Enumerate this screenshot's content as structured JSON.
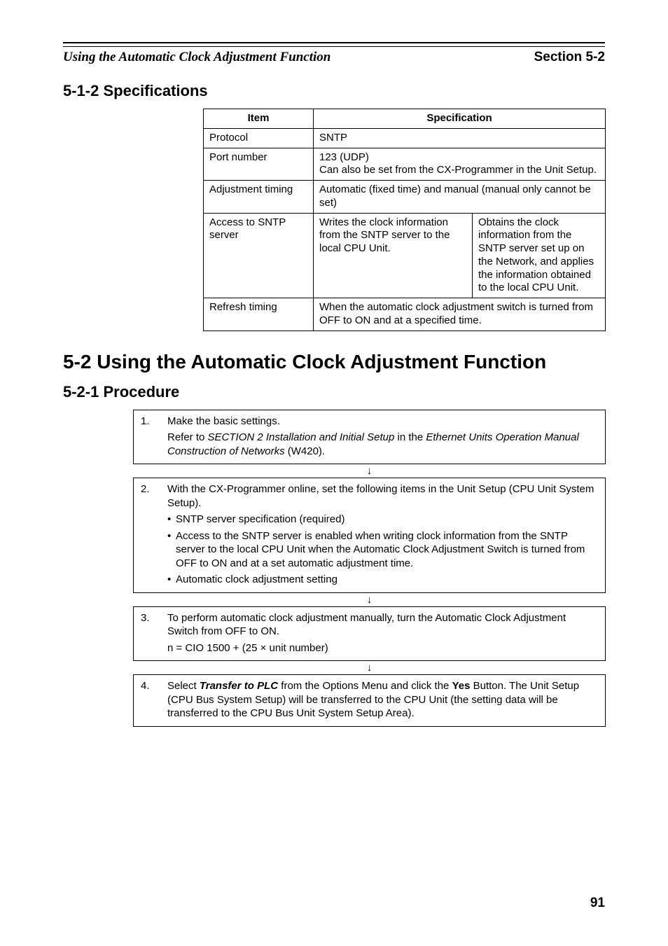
{
  "header": {
    "running_title": "Using the Automatic Clock Adjustment Function",
    "section_ref": "Section 5-2"
  },
  "h3_1": "5-1-2    Specifications",
  "spec_table": {
    "head_item": "Item",
    "head_spec": "Specification",
    "rows": {
      "protocol_label": "Protocol",
      "protocol_value": "SNTP",
      "port_label": "Port number",
      "port_value_l1": "123 (UDP)",
      "port_value_l2": "Can also be set from the CX-Programmer in the Unit Setup.",
      "adj_label": "Adjustment timing",
      "adj_value": "Automatic (fixed time) and manual (manual only cannot be set)",
      "access_label": "Access to SNTP server",
      "access_left": "Writes the clock information from the SNTP server to the local CPU Unit.",
      "access_right": "Obtains the clock information from the SNTP server set up on the Network, and applies the information obtained to the local CPU Unit.",
      "refresh_label": "Refresh timing",
      "refresh_value": "When the automatic clock adjustment switch is turned from OFF to ON and at a specified time."
    }
  },
  "h2": "5-2    Using the Automatic Clock Adjustment Function",
  "h3_2": "5-2-1    Procedure",
  "steps": {
    "s1_num": "1.",
    "s1_line1": "Make the basic settings.",
    "s1_line2a": "Refer to ",
    "s1_line2b": "SECTION 2 Installation and Initial Setup",
    "s1_line2c": " in the ",
    "s1_line2d": "Ethernet Units Operation Manual Construction of Networks",
    "s1_line2e": " (W420).",
    "s2_num": "2.",
    "s2_line1": "With the CX-Programmer online, set the following items in the Unit Setup (CPU Unit System Setup).",
    "s2_b1": "SNTP server specification (required)",
    "s2_b2": "Access to the SNTP server is enabled when writing clock information from the SNTP server to the local CPU Unit when the Automatic Clock Adjustment Switch is turned from OFF to ON and at a set automatic adjustment time.",
    "s2_b3": "Automatic clock adjustment setting",
    "s3_num": "3.",
    "s3_line1": "To perform automatic clock adjustment manually, turn the Automatic Clock Adjustment Switch from OFF to ON.",
    "s3_line2": "n = CIO 1500 + (25 × unit number)",
    "s4_num": "4.",
    "s4_a": "Select ",
    "s4_b": "Transfer to PLC",
    "s4_c": " from the Options Menu and click the ",
    "s4_d": "Yes",
    "s4_e": " Button. The Unit Setup (CPU Bus System Setup) will be transferred to the CPU Unit (the setting data will be transferred to the CPU Bus Unit System Setup Area).",
    "arrow": "↓"
  },
  "page_number": "91"
}
